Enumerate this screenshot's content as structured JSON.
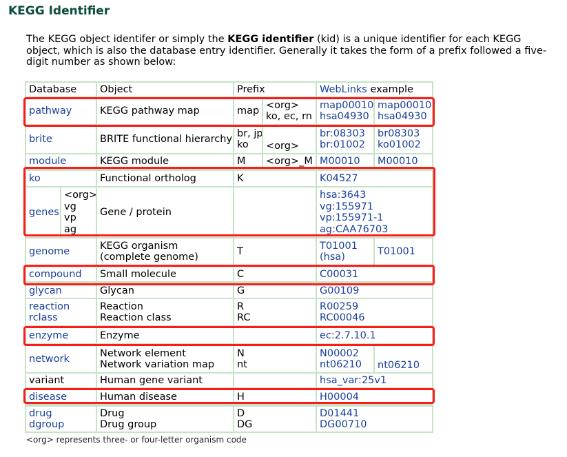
{
  "heading": "KEGG Identifier",
  "intro": {
    "part1": "The KEGG object identifer or simply the ",
    "bold": "KEGG identifier",
    "part2": " (kid) is a unique identifier for each KEGG object, which is also the database entry identifier. Generally it takes the form of a prefix followed a five-digit number as shown below:"
  },
  "table": {
    "headers": {
      "database": "Database",
      "object": "Object",
      "prefix": "Prefix",
      "weblinks_link": "WebLinks",
      "weblinks_rest": " example"
    },
    "rows": {
      "pathway": {
        "db": "pathway",
        "object": "KEGG pathway map",
        "prefix1": "map",
        "prefix2": "<org>",
        "prefix3": "ko, ec, rn",
        "ex1a": "map00010",
        "ex1b": "hsa04930",
        "ex2a": "map00010",
        "ex2b": "hsa04930"
      },
      "brite": {
        "db": "brite",
        "object": "BRITE functional hierarchy",
        "prefix1a": "br, jp",
        "prefix1b": "ko",
        "prefix2": "<org>",
        "ex1a": "br:08303",
        "ex1b": "br:01002",
        "ex2a": "br08303",
        "ex2b": "ko01002"
      },
      "module": {
        "db": "module",
        "object": "KEGG module",
        "prefix1": "M",
        "prefix2": "<org>_M",
        "ex1": "M00010",
        "ex2": "M00010"
      },
      "ko": {
        "db": "ko",
        "object": "Functional ortholog",
        "prefix": "K",
        "ex": "K04527"
      },
      "genes": {
        "db": "genes",
        "sub": [
          "<org>",
          "vg",
          "vp",
          "ag"
        ],
        "object": "Gene / protein",
        "ex": [
          "hsa:3643",
          "vg:155971",
          "vp:155971-1",
          "ag:CAA76703"
        ]
      },
      "genome": {
        "db": "genome",
        "object1": "KEGG organism",
        "object2": "(complete genome)",
        "prefix": "T",
        "ex1a": "T01001",
        "ex1b": "(hsa)",
        "ex2": "T01001"
      },
      "compound": {
        "db": "compound",
        "object": "Small molecule",
        "prefix": "C",
        "ex": "C00031"
      },
      "glycan": {
        "db": "glycan",
        "object": "Glycan",
        "prefix": "G",
        "ex": "G00109"
      },
      "reaction": {
        "db1": "reaction",
        "db2": "rclass",
        "object1": "Reaction",
        "object2": "Reaction class",
        "prefix1": "R",
        "prefix2": "RC",
        "ex1": "R00259",
        "ex2": "RC00046"
      },
      "enzyme": {
        "db": "enzyme",
        "object": "Enzyme",
        "prefix": "",
        "ex": "ec:2.7.10.1"
      },
      "network": {
        "db": "network",
        "object1": "Network element",
        "object2": "Network variation map",
        "prefix1": "N",
        "prefix2": "nt",
        "ex1a": "N00002",
        "ex1b": "nt06210",
        "ex2": "nt06210"
      },
      "variant": {
        "db": "variant",
        "object": "Human gene variant",
        "prefix": "",
        "ex": "hsa_var:25v1"
      },
      "disease": {
        "db": "disease",
        "object": "Human disease",
        "prefix": "H",
        "ex": "H00004"
      },
      "drug": {
        "db1": "drug",
        "db2": "dgroup",
        "object1": "Drug",
        "object2": "Drug group",
        "prefix1": "D",
        "prefix2": "DG",
        "ex1": "D01441",
        "ex2": "DG00710"
      }
    }
  },
  "footnote": "<org> represents three- or four-letter organism code",
  "colors": {
    "heading": "#0d4d3f",
    "link": "#1a3e9a",
    "table_border": "#c6e3c6",
    "highlight": "#ff1a1a"
  }
}
